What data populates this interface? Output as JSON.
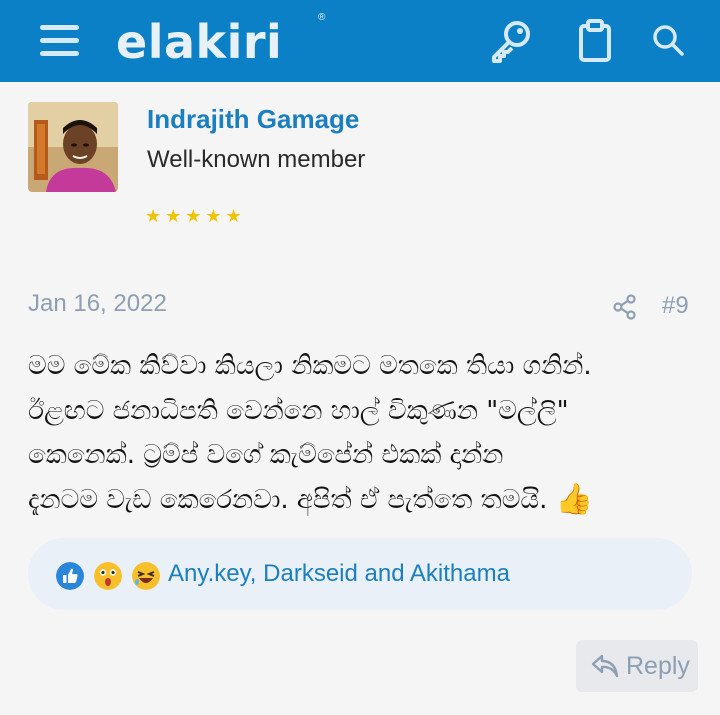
{
  "header": {
    "logo_text": "elakiri",
    "logo_mark": "®",
    "icons": [
      "menu-icon",
      "key-icon",
      "clipboard-icon",
      "search-icon"
    ]
  },
  "post": {
    "author": {
      "name": "Indrajith Gamage",
      "title": "Well-known member",
      "stars": "★★★★★"
    },
    "date": "Jan 16, 2022",
    "number": "#9",
    "body_lines": [
      "මම මේක කිව්වා කියලා නිකමට මතකෙ තියා ගනින්.",
      "ඊළඟට ජනාධිපති වෙන්නෙ හාල් විකුණන \"මල්ලි\"",
      "කෙනෙක්. ට්‍රම්ප් වගේ කැම්පේන් එකක් දාන්න",
      "දැනටම වැඩ කෙරෙනවා. අපිත් ඒ පැත්තෙ තමයි."
    ],
    "body_emoji": "👍",
    "reactions": {
      "icons": [
        "like-icon",
        "wow-icon",
        "haha-icon"
      ],
      "users_text": "Any.key, Darkseid and Akithama"
    },
    "reply_label": "Reply"
  },
  "colors": {
    "header_bg": "#0b80c6",
    "link": "#1a7fc1",
    "muted": "#8e9fb3",
    "star": "#f0c400"
  }
}
